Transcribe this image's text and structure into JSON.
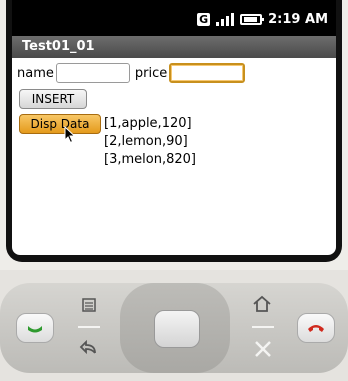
{
  "status_bar": {
    "network_badge": "G",
    "time": "2:19 AM",
    "icons": [
      "network-g-icon",
      "signal-icon",
      "battery-icon"
    ]
  },
  "app": {
    "title": "Test01_01"
  },
  "form": {
    "name_label": "name",
    "name_value": "",
    "price_label": "price",
    "price_value": ""
  },
  "buttons": {
    "insert_label": "INSERT",
    "disp_label": "Disp Data"
  },
  "results": [
    "[1,apple,120]",
    "[2,lemon,90]",
    "[3,melon,820]"
  ],
  "hardware": {
    "buttons": [
      "call-icon",
      "menu-icon",
      "back-icon",
      "dpad-center",
      "home-icon",
      "search-icon",
      "end-call-icon"
    ]
  },
  "colors": {
    "accent": "#e49a1c",
    "focus_border": "#c8901d",
    "title_bar": "#4a4a4a",
    "call_green": "#2e9a2e",
    "end_red": "#d02a1e"
  }
}
